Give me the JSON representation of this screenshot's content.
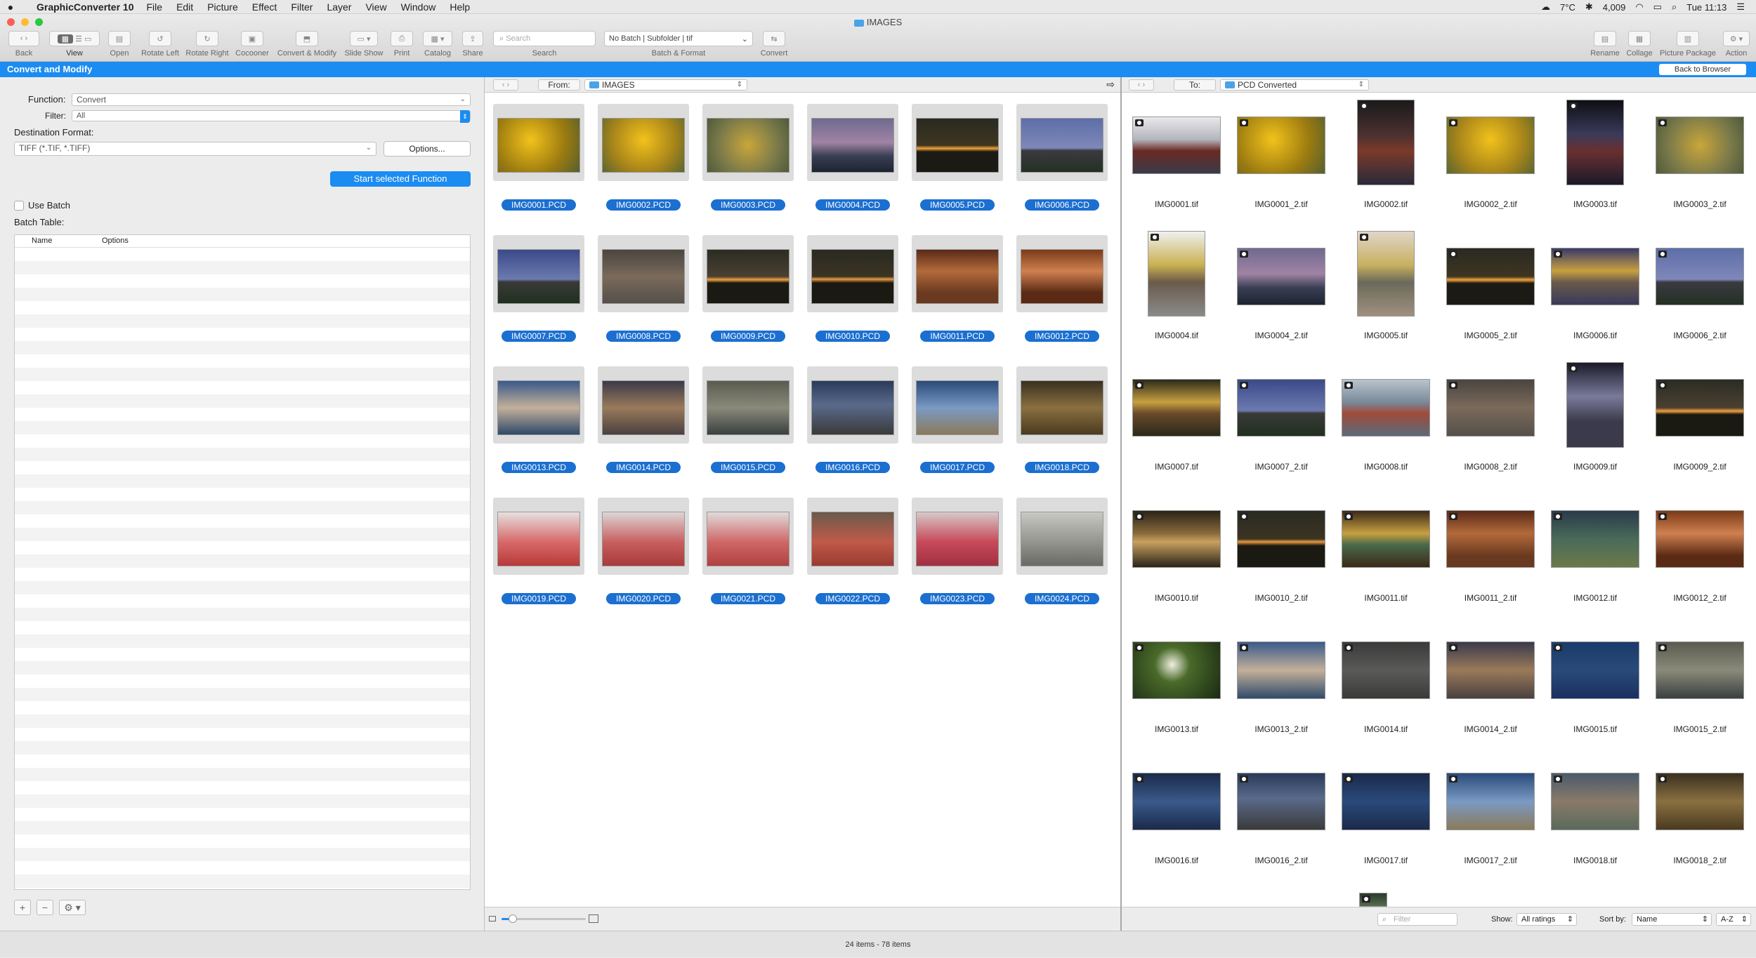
{
  "menubar": {
    "apple": "",
    "app_name": "GraphicConverter 10",
    "items": [
      "File",
      "Edit",
      "Picture",
      "Effect",
      "Filter",
      "Layer",
      "View",
      "Window",
      "Help"
    ],
    "temperature": "7°C",
    "stock": "4,009",
    "clock": "Tue 11:13"
  },
  "window": {
    "title": "IMAGES"
  },
  "toolbar": {
    "back": "Back",
    "view": "View",
    "open": "Open",
    "rotate_left": "Rotate Left",
    "rotate_right": "Rotate Right",
    "cocooner": "Cocooner",
    "convert_modify": "Convert & Modify",
    "slide_show": "Slide Show",
    "print": "Print",
    "catalog": "Catalog",
    "share": "Share",
    "search_label": "Search",
    "search_placeholder": "Search",
    "batch_value": "No Batch | Subfolder | tif",
    "batch_label": "Batch & Format",
    "convert": "Convert",
    "rename": "Rename",
    "collage": "Collage",
    "picture_package": "Picture Package",
    "action": "Action"
  },
  "header": {
    "title": "Convert and Modify",
    "back_to_browser": "Back to Browser"
  },
  "left_panel": {
    "function_label": "Function:",
    "function_value": "Convert",
    "filter_label": "Filter:",
    "filter_value": "All",
    "dest_format_label": "Destination Format:",
    "dest_format_value": "TIFF (*.TIF, *.TIFF)",
    "options_button": "Options...",
    "start_button": "Start selected Function",
    "use_batch": "Use Batch",
    "batch_table_label": "Batch Table:",
    "col_name": "Name",
    "col_options": "Options",
    "add": "+",
    "remove": "−",
    "gear": "⚙"
  },
  "source": {
    "from_label": "From:",
    "folder": "IMAGES",
    "files": [
      "IMG0001.PCD",
      "IMG0002.PCD",
      "IMG0003.PCD",
      "IMG0004.PCD",
      "IMG0005.PCD",
      "IMG0006.PCD",
      "IMG0007.PCD",
      "IMG0008.PCD",
      "IMG0009.PCD",
      "IMG0010.PCD",
      "IMG0011.PCD",
      "IMG0012.PCD",
      "IMG0013.PCD",
      "IMG0014.PCD",
      "IMG0015.PCD",
      "IMG0016.PCD",
      "IMG0017.PCD",
      "IMG0018.PCD",
      "IMG0019.PCD",
      "IMG0020.PCD",
      "IMG0021.PCD",
      "IMG0022.PCD",
      "IMG0023.PCD",
      "IMG0024.PCD"
    ]
  },
  "destination": {
    "to_label": "To:",
    "folder": "PCD Converted",
    "files": [
      "IMG0001.tif",
      "IMG0001_2.tif",
      "IMG0002.tif",
      "IMG0002_2.tif",
      "IMG0003.tif",
      "IMG0003_2.tif",
      "IMG0004.tif",
      "IMG0004_2.tif",
      "IMG0005.tif",
      "IMG0005_2.tif",
      "IMG0006.tif",
      "IMG0006_2.tif",
      "IMG0007.tif",
      "IMG0007_2.tif",
      "IMG0008.tif",
      "IMG0008_2.tif",
      "IMG0009.tif",
      "IMG0009_2.tif",
      "IMG0010.tif",
      "IMG0010_2.tif",
      "IMG0011.tif",
      "IMG0011_2.tif",
      "IMG0012.tif",
      "IMG0012_2.tif",
      "IMG0013.tif",
      "IMG0013_2.tif",
      "IMG0014.tif",
      "IMG0014_2.tif",
      "IMG0015.tif",
      "IMG0015_2.tif",
      "IMG0016.tif",
      "IMG0016_2.tif",
      "IMG0017.tif",
      "IMG0017_2.tif",
      "IMG0018.tif",
      "IMG0018_2.tif"
    ],
    "filter_placeholder": "Filter",
    "show_label": "Show:",
    "show_value": "All ratings",
    "sort_label": "Sort by:",
    "sort_value": "Name",
    "sort_order": "A-Z"
  },
  "status": {
    "text": "24 items - 78 items"
  },
  "colors": {
    "accent": "#1b8cf2",
    "selection": "#1b6fd0"
  }
}
